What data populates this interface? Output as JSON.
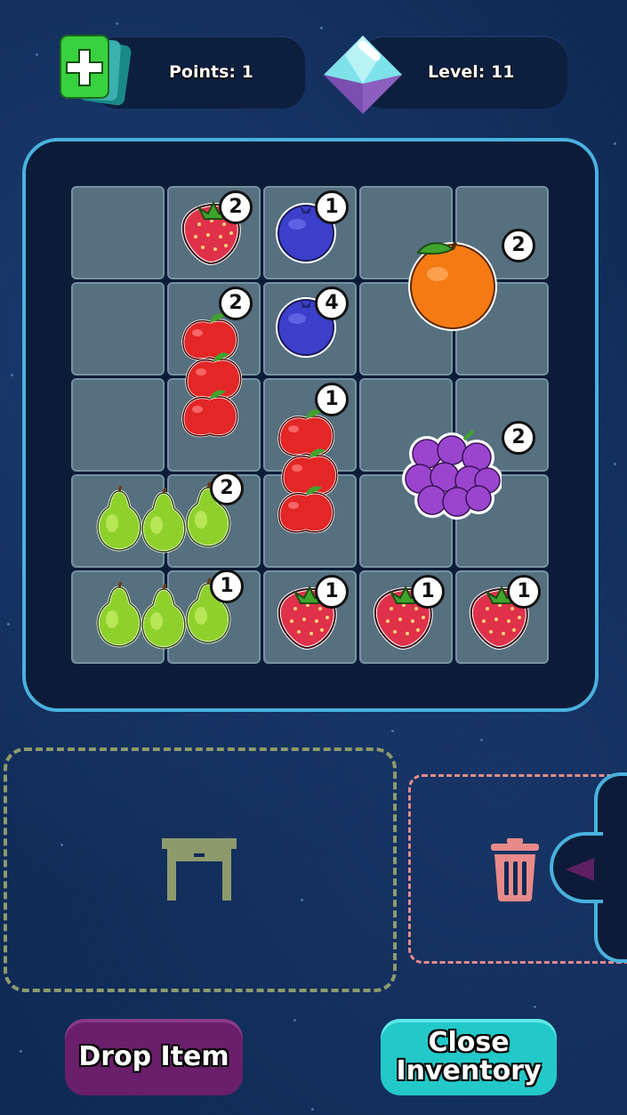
{
  "hud": {
    "points_label": "Points: 1",
    "level_label": "Level: 11",
    "points_icon": "card-plus-icon",
    "level_icon": "diamond-gem-icon"
  },
  "inventory": {
    "items": [
      {
        "name": "strawberry",
        "count": "2"
      },
      {
        "name": "blueberry",
        "count": "1"
      },
      {
        "name": "orange",
        "count": "2"
      },
      {
        "name": "apples",
        "count": "2"
      },
      {
        "name": "blueberry",
        "count": "4"
      },
      {
        "name": "apples",
        "count": "1"
      },
      {
        "name": "grapes",
        "count": "2"
      },
      {
        "name": "pears",
        "count": "2"
      },
      {
        "name": "pears",
        "count": "1"
      },
      {
        "name": "strawberry",
        "count": "1"
      },
      {
        "name": "strawberry",
        "count": "1"
      },
      {
        "name": "strawberry",
        "count": "1"
      }
    ]
  },
  "zones": {
    "drop_icon": "table-icon",
    "trash_icon": "trash-icon",
    "side_icon": "triangle-left-icon"
  },
  "buttons": {
    "drop_item": "Drop Item",
    "close_inventory_line1": "Close",
    "close_inventory_line2": "Inventory"
  },
  "colors": {
    "accent": "#49b2de",
    "drop_button": "#6a1f6a",
    "close_button": "#23c9c9",
    "drop_zone": "#8d9a6c",
    "trash_zone": "#e88a8a"
  }
}
